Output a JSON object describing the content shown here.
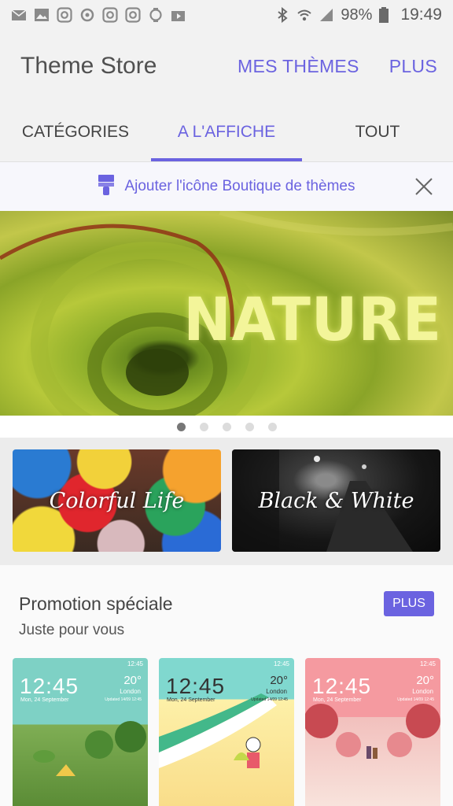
{
  "status_bar": {
    "battery": "98%",
    "time": "19:49",
    "left_icons": [
      "mail-icon",
      "gallery-icon",
      "instagram-icon",
      "sync-icon",
      "instagram-icon",
      "instagram-icon",
      "watch-icon",
      "video-icon"
    ],
    "right_icons": [
      "bluetooth-icon",
      "wifi-icon",
      "signal-icon",
      "battery-icon"
    ]
  },
  "app_bar": {
    "title": "Theme Store",
    "actions": [
      "MES THÈMES",
      "PLUS"
    ]
  },
  "tabs": [
    {
      "label": "CATÉGORIES",
      "active": false
    },
    {
      "label": "A L'AFFICHE",
      "active": true
    },
    {
      "label": "TOUT",
      "active": false
    }
  ],
  "notice": {
    "text": "Ajouter l'icône Boutique de thèmes",
    "icon": "paint-brush-icon"
  },
  "hero": {
    "word": "NATURE",
    "page_count": 5,
    "active_page": 1
  },
  "categories": [
    {
      "label": "Colorful Life"
    },
    {
      "label": "Black & White"
    }
  ],
  "promotion": {
    "title": "Promotion spéciale",
    "subtitle": "Juste pour vous",
    "more_label": "PLUS",
    "themes": [
      {
        "time": "12:45",
        "date": "Mon, 24 September",
        "temp": "20°",
        "location": "London",
        "updated": "Updated 14/09 12:45"
      },
      {
        "time": "12:45",
        "date": "Mon, 24 September",
        "temp": "20°",
        "location": "London",
        "updated": "Updated 14/09 12:45"
      },
      {
        "time": "12:45",
        "date": "Mon, 24 September",
        "temp": "20°",
        "location": "London",
        "updated": "Updated 14/09 12:45"
      }
    ],
    "status_time": "12:45"
  },
  "colors": {
    "accent": "#6b63e0",
    "bar_bg": "#f2f2f2"
  }
}
